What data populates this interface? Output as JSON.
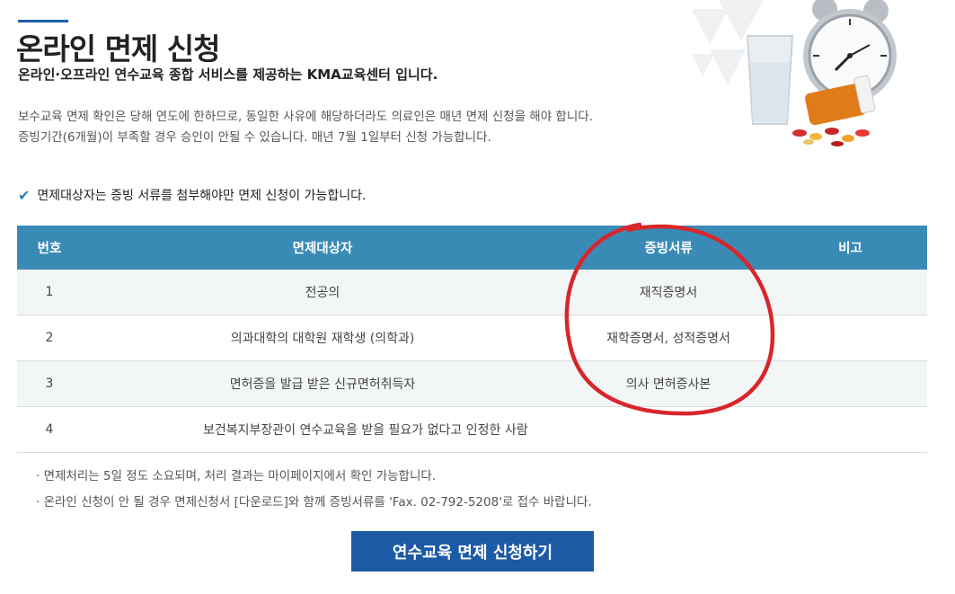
{
  "header": {
    "title": "온라인 면제 신청",
    "subtitle": "온라인·오프라인 연수교육 종합 서비스를 제공하는 KMA교육센터 입니다.",
    "desc_line1": "보수교육 면제 확인은 당해 연도에 한하므로, 동일한 사유에 해당하더라도 의료인은 매년 면제 신청을 해야 합니다.",
    "desc_line2": "증빙기간(6개월)이 부족할 경우 승인이 안될 수 있습니다. 매년 7월 1일부터 신청 가능합니다."
  },
  "notice": "면제대상자는 증빙 서류를 첨부해야만 면제 신청이 가능합니다.",
  "table": {
    "headers": [
      "번호",
      "면제대상자",
      "증빙서류",
      "비고"
    ],
    "rows": [
      {
        "no": "1",
        "target": "전공의",
        "docs": "재직증명서",
        "note": ""
      },
      {
        "no": "2",
        "target": "의과대학의 대학원 재학생 (의학과)",
        "docs": "재학증명서, 성적증명서",
        "note": ""
      },
      {
        "no": "3",
        "target": "면허증을 발급 받은 신규면허취득자",
        "docs": "의사 면허증사본",
        "note": ""
      },
      {
        "no": "4",
        "target": "보건복지부장관이 연수교육을 받을 필요가 없다고 인정한 사람",
        "docs": "",
        "note": ""
      }
    ]
  },
  "notes": [
    "· 면제처리는 5일 정도 소요되며, 처리 결과는 마이페이지에서 확인 가능합니다.",
    "· 온라인 신청이 안 될 경우 면제신청서 [다운로드]와 함께 증빙서류를 'Fax. 02-792-5208'로 접수 바랍니다."
  ],
  "button": {
    "label": "연수교육 면제 신청하기"
  },
  "colors": {
    "accent": "#1d5aa6",
    "table_header": "#3a8ab6",
    "circle": "#d8262a"
  },
  "icons": {
    "notice": "check-icon",
    "hero": "alarm-clock-pills-illustration"
  }
}
